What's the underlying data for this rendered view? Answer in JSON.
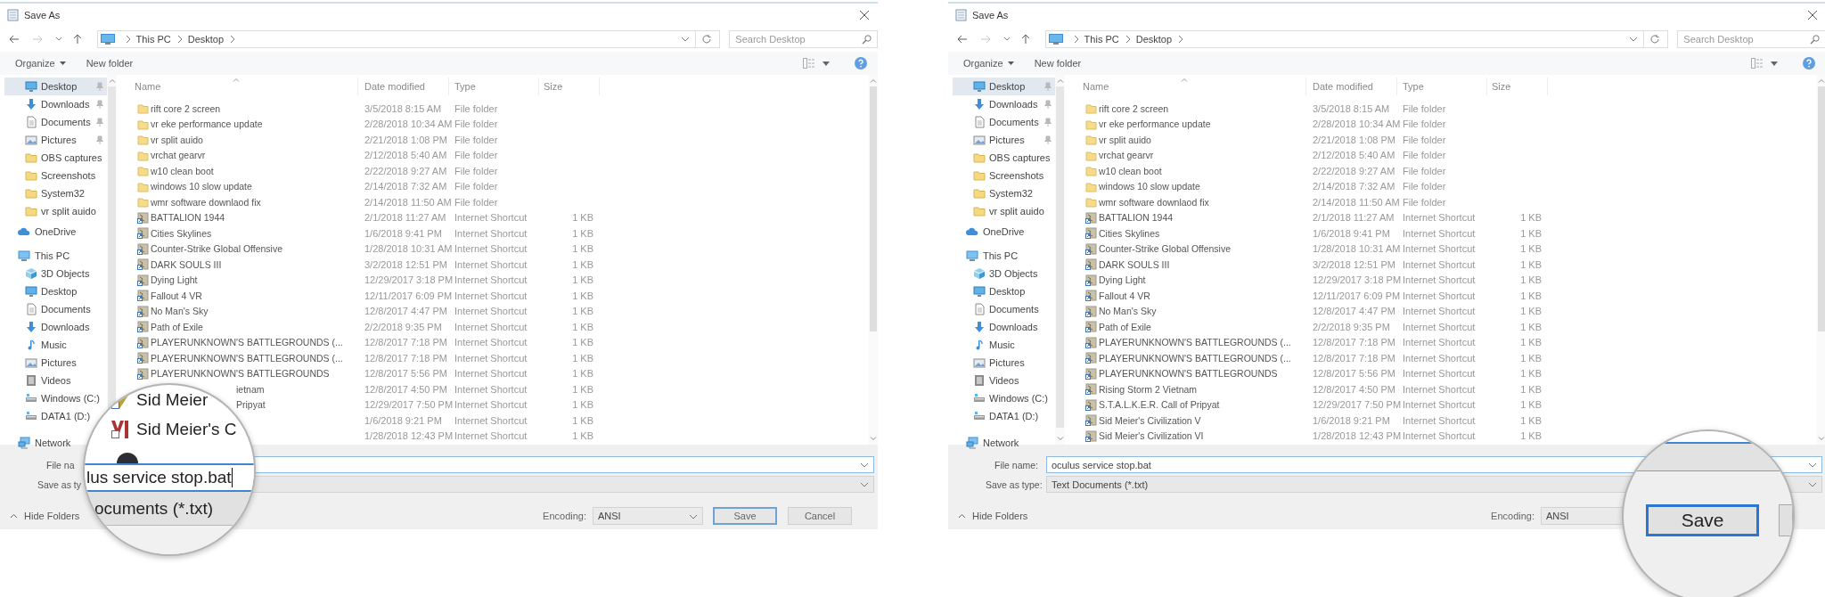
{
  "dialogs": [
    {
      "title": "Save As",
      "path": [
        "This PC",
        "Desktop"
      ],
      "search_placeholder": "Search Desktop",
      "organize": "Organize",
      "new_folder": "New folder",
      "sidebar": {
        "pinned": [
          {
            "label": "Desktop",
            "kind": "desktop",
            "pinned": true,
            "selected": true
          },
          {
            "label": "Downloads",
            "kind": "downloads",
            "pinned": true,
            "selected": false
          },
          {
            "label": "Documents",
            "kind": "documents",
            "pinned": true,
            "selected": false
          },
          {
            "label": "Pictures",
            "kind": "pictures",
            "pinned": true,
            "selected": false
          },
          {
            "label": "OBS captures",
            "kind": "folder",
            "pinned": false,
            "selected": false
          },
          {
            "label": "Screenshots",
            "kind": "folder",
            "pinned": false,
            "selected": false
          },
          {
            "label": "System32",
            "kind": "folder",
            "pinned": false,
            "selected": false
          },
          {
            "label": "vr split auido",
            "kind": "folder",
            "pinned": false,
            "selected": false
          }
        ],
        "locations": [
          {
            "label": "OneDrive",
            "kind": "cloud",
            "selected": false
          },
          {
            "label": "This PC",
            "kind": "pc",
            "selected": false,
            "children": [
              {
                "label": "3D Objects",
                "kind": "cube",
                "selected": false
              },
              {
                "label": "Desktop",
                "kind": "desktop",
                "selected": false
              },
              {
                "label": "Documents",
                "kind": "documents",
                "selected": false
              },
              {
                "label": "Downloads",
                "kind": "downloads",
                "selected": false
              },
              {
                "label": "Music",
                "kind": "music",
                "selected": false
              },
              {
                "label": "Pictures",
                "kind": "pictures",
                "selected": false
              },
              {
                "label": "Videos",
                "kind": "videos",
                "selected": false
              },
              {
                "label": "Windows (C:)",
                "kind": "drive",
                "selected": false
              },
              {
                "label": "DATA1 (D:)",
                "kind": "drive",
                "selected": false
              }
            ]
          },
          {
            "label": "Network",
            "kind": "network",
            "selected": false
          }
        ]
      },
      "columns": [
        "Name",
        "Date modified",
        "Type",
        "Size"
      ],
      "rows": [
        {
          "kind": "folder",
          "name": "rift core 2 screen",
          "date": "3/5/2018 8:15 AM",
          "type": "File folder"
        },
        {
          "kind": "folder",
          "name": "vr eke performance update",
          "date": "2/28/2018 10:34 AM",
          "type": "File folder"
        },
        {
          "kind": "folder",
          "name": "vr split auido",
          "date": "2/21/2018 1:08 PM",
          "type": "File folder"
        },
        {
          "kind": "folder",
          "name": "vrchat gearvr",
          "date": "2/12/2018 5:40 AM",
          "type": "File folder"
        },
        {
          "kind": "folder",
          "name": "w10 clean boot",
          "date": "2/22/2018 9:27 AM",
          "type": "File folder"
        },
        {
          "kind": "folder",
          "name": "windows 10 slow update",
          "date": "2/14/2018 7:32 AM",
          "type": "File folder"
        },
        {
          "kind": "folder",
          "name": "wmr software downlaod fix",
          "date": "2/14/2018 11:50 AM",
          "type": "File folder"
        },
        {
          "kind": "shortcut",
          "name": "BATTALION 1944",
          "date": "2/1/2018 11:27 AM",
          "type": "Internet Shortcut",
          "size": "1 KB"
        },
        {
          "kind": "shortcut",
          "name": "Cities Skylines",
          "date": "1/6/2018 9:41 PM",
          "type": "Internet Shortcut",
          "size": "1 KB"
        },
        {
          "kind": "shortcut",
          "name": "Counter-Strike Global Offensive",
          "date": "1/28/2018 10:31 AM",
          "type": "Internet Shortcut",
          "size": "1 KB"
        },
        {
          "kind": "shortcut",
          "name": "DARK SOULS III",
          "date": "3/2/2018 12:51 PM",
          "type": "Internet Shortcut",
          "size": "1 KB"
        },
        {
          "kind": "shortcut",
          "name": "Dying Light",
          "date": "12/29/2017 3:18 PM",
          "type": "Internet Shortcut",
          "size": "1 KB"
        },
        {
          "kind": "shortcut",
          "name": "Fallout 4 VR",
          "date": "12/11/2017 6:09 PM",
          "type": "Internet Shortcut",
          "size": "1 KB"
        },
        {
          "kind": "shortcut",
          "name": "No Man's Sky",
          "date": "12/8/2017 4:47 PM",
          "type": "Internet Shortcut",
          "size": "1 KB"
        },
        {
          "kind": "shortcut",
          "name": "Path of Exile",
          "date": "2/2/2018 9:35 PM",
          "type": "Internet Shortcut",
          "size": "1 KB"
        },
        {
          "kind": "shortcut",
          "name": "PLAYERUNKNOWN'S BATTLEGROUNDS (...",
          "date": "12/8/2017 7:18 PM",
          "type": "Internet Shortcut",
          "size": "1 KB"
        },
        {
          "kind": "shortcut",
          "name": "PLAYERUNKNOWN'S BATTLEGROUNDS (...",
          "date": "12/8/2017 7:18 PM",
          "type": "Internet Shortcut",
          "size": "1 KB"
        },
        {
          "kind": "shortcut",
          "name": "PLAYERUNKNOWN'S BATTLEGROUNDS",
          "date": "12/8/2017 5:56 PM",
          "type": "Internet Shortcut",
          "size": "1 KB"
        },
        {
          "name_tail": "ietnam",
          "date": "12/8/2017 4:50 PM",
          "type": "Internet Shortcut",
          "size": "1 KB"
        },
        {
          "name_tail": "Pripyat",
          "date": "12/29/2017 7:50 PM",
          "type": "Internet Shortcut",
          "size": "1 KB"
        },
        {
          "date": "1/6/2018 9:21 PM",
          "type": "Internet Shortcut",
          "size": "1 KB"
        },
        {
          "date": "1/28/2018 12:43 PM",
          "type": "Internet Shortcut",
          "size": "1 KB"
        }
      ],
      "file_name": {
        "label": "File na"
      },
      "save_type": {
        "label": "Save as ty"
      },
      "hide_folders": "Hide Folders",
      "encoding": {
        "label": "Encoding:",
        "value": "ANSI"
      },
      "buttons": [
        {
          "label": "Save",
          "default": true
        },
        {
          "label": "Cancel",
          "default": false
        }
      ],
      "magnifier": {
        "kind": "fields",
        "rows": [
          "Sid Meier",
          "Sid Meier's C"
        ],
        "file_name": "lus service stop.bat",
        "save_type": "ocuments (*.txt)"
      }
    },
    {
      "title": "Save As",
      "path": [
        "This PC",
        "Desktop"
      ],
      "search_placeholder": "Search Desktop",
      "organize": "Organize",
      "new_folder": "New folder",
      "sidebar": {
        "pinned": [
          {
            "label": "Desktop",
            "kind": "desktop",
            "pinned": true,
            "selected": true
          },
          {
            "label": "Downloads",
            "kind": "downloads",
            "pinned": true,
            "selected": false
          },
          {
            "label": "Documents",
            "kind": "documents",
            "pinned": true,
            "selected": false
          },
          {
            "label": "Pictures",
            "kind": "pictures",
            "pinned": true,
            "selected": false
          },
          {
            "label": "OBS captures",
            "kind": "folder",
            "pinned": false,
            "selected": false
          },
          {
            "label": "Screenshots",
            "kind": "folder",
            "pinned": false,
            "selected": false
          },
          {
            "label": "System32",
            "kind": "folder",
            "pinned": false,
            "selected": false
          },
          {
            "label": "vr split auido",
            "kind": "folder",
            "pinned": false,
            "selected": false
          }
        ],
        "locations": [
          {
            "label": "OneDrive",
            "kind": "cloud",
            "selected": false
          },
          {
            "label": "This PC",
            "kind": "pc",
            "selected": false,
            "children": [
              {
                "label": "3D Objects",
                "kind": "cube",
                "selected": false
              },
              {
                "label": "Desktop",
                "kind": "desktop",
                "selected": false
              },
              {
                "label": "Documents",
                "kind": "documents",
                "selected": false
              },
              {
                "label": "Downloads",
                "kind": "downloads",
                "selected": false
              },
              {
                "label": "Music",
                "kind": "music",
                "selected": false
              },
              {
                "label": "Pictures",
                "kind": "pictures",
                "selected": false
              },
              {
                "label": "Videos",
                "kind": "videos",
                "selected": false
              },
              {
                "label": "Windows (C:)",
                "kind": "drive",
                "selected": false
              },
              {
                "label": "DATA1 (D:)",
                "kind": "drive",
                "selected": false
              }
            ]
          },
          {
            "label": "Network",
            "kind": "network",
            "selected": false
          }
        ]
      },
      "columns": [
        "Name",
        "Date modified",
        "Type",
        "Size"
      ],
      "rows": [
        {
          "kind": "folder",
          "name": "rift core 2 screen",
          "date": "3/5/2018 8:15 AM",
          "type": "File folder"
        },
        {
          "kind": "folder",
          "name": "vr eke performance update",
          "date": "2/28/2018 10:34 AM",
          "type": "File folder"
        },
        {
          "kind": "folder",
          "name": "vr split auido",
          "date": "2/21/2018 1:08 PM",
          "type": "File folder"
        },
        {
          "kind": "folder",
          "name": "vrchat gearvr",
          "date": "2/12/2018 5:40 AM",
          "type": "File folder"
        },
        {
          "kind": "folder",
          "name": "w10 clean boot",
          "date": "2/22/2018 9:27 AM",
          "type": "File folder"
        },
        {
          "kind": "folder",
          "name": "windows 10 slow update",
          "date": "2/14/2018 7:32 AM",
          "type": "File folder"
        },
        {
          "kind": "folder",
          "name": "wmr software downlaod fix",
          "date": "2/14/2018 11:50 AM",
          "type": "File folder"
        },
        {
          "kind": "shortcut",
          "name": "BATTALION 1944",
          "date": "2/1/2018 11:27 AM",
          "type": "Internet Shortcut",
          "size": "1 KB"
        },
        {
          "kind": "shortcut",
          "name": "Cities Skylines",
          "date": "1/6/2018 9:41 PM",
          "type": "Internet Shortcut",
          "size": "1 KB"
        },
        {
          "kind": "shortcut",
          "name": "Counter-Strike Global Offensive",
          "date": "1/28/2018 10:31 AM",
          "type": "Internet Shortcut",
          "size": "1 KB"
        },
        {
          "kind": "shortcut",
          "name": "DARK SOULS III",
          "date": "3/2/2018 12:51 PM",
          "type": "Internet Shortcut",
          "size": "1 KB"
        },
        {
          "kind": "shortcut",
          "name": "Dying Light",
          "date": "12/29/2017 3:18 PM",
          "type": "Internet Shortcut",
          "size": "1 KB"
        },
        {
          "kind": "shortcut",
          "name": "Fallout 4 VR",
          "date": "12/11/2017 6:09 PM",
          "type": "Internet Shortcut",
          "size": "1 KB"
        },
        {
          "kind": "shortcut",
          "name": "No Man's Sky",
          "date": "12/8/2017 4:47 PM",
          "type": "Internet Shortcut",
          "size": "1 KB"
        },
        {
          "kind": "shortcut",
          "name": "Path of Exile",
          "date": "2/2/2018 9:35 PM",
          "type": "Internet Shortcut",
          "size": "1 KB"
        },
        {
          "kind": "shortcut",
          "name": "PLAYERUNKNOWN'S BATTLEGROUNDS (...",
          "date": "12/8/2017 7:18 PM",
          "type": "Internet Shortcut",
          "size": "1 KB"
        },
        {
          "kind": "shortcut",
          "name": "PLAYERUNKNOWN'S BATTLEGROUNDS (...",
          "date": "12/8/2017 7:18 PM",
          "type": "Internet Shortcut",
          "size": "1 KB"
        },
        {
          "kind": "shortcut",
          "name": "PLAYERUNKNOWN'S BATTLEGROUNDS",
          "date": "12/8/2017 5:56 PM",
          "type": "Internet Shortcut",
          "size": "1 KB"
        },
        {
          "kind": "shortcut",
          "name": "Rising Storm 2 Vietnam",
          "date": "12/8/2017 4:50 PM",
          "type": "Internet Shortcut",
          "size": "1 KB"
        },
        {
          "kind": "shortcut",
          "name": "S.T.A.L.K.E.R. Call of Pripyat",
          "date": "12/29/2017 7:50 PM",
          "type": "Internet Shortcut",
          "size": "1 KB"
        },
        {
          "kind": "shortcut",
          "name": "Sid Meier's Civilization V",
          "date": "1/6/2018 9:21 PM",
          "type": "Internet Shortcut",
          "size": "1 KB"
        },
        {
          "kind": "shortcut",
          "name": "Sid Meier's Civilization VI",
          "date": "1/28/2018 12:43 PM",
          "type": "Internet Shortcut",
          "size": "1 KB"
        }
      ],
      "file_name": {
        "label": "File name:",
        "value": "oculus service stop.bat"
      },
      "save_type": {
        "label": "Save as type:",
        "value": "Text Documents (*.txt)"
      },
      "hide_folders": "Hide Folders",
      "encoding": {
        "label": "Encoding:",
        "value": "ANSI"
      },
      "magnifier": {
        "kind": "button",
        "button": {
          "label": "Save",
          "default": true
        }
      }
    }
  ]
}
